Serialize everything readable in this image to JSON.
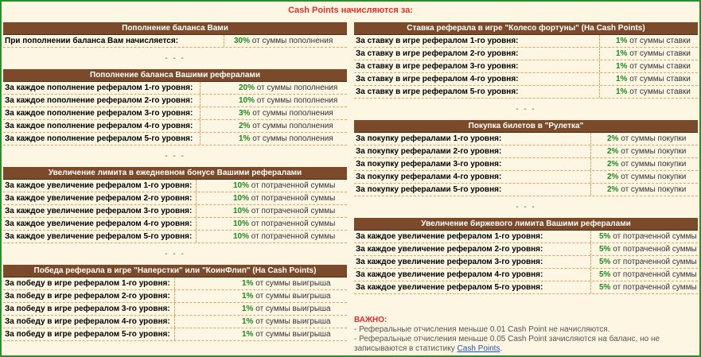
{
  "title": "Cash Points начисляются за:",
  "separator": "- - -",
  "left": [
    {
      "header": "Пополнение баланса Вами",
      "label_w": 275,
      "value_indent": 12,
      "rows": [
        {
          "label": "При пополнении баланса Вам начисляется:",
          "pct": "30%",
          "text": "от суммы пополнения"
        }
      ]
    },
    {
      "header": "Пополнение баланса Вашими рефералами",
      "label_w": 245,
      "value_indent": 48,
      "rows": [
        {
          "label": "За каждое пополнение рефералом 1-го уровня:",
          "pct": "20%",
          "text": "от суммы пополнения"
        },
        {
          "label": "За каждое пополнение рефералом 2-го уровня:",
          "pct": "10%",
          "text": "от суммы пополнения"
        },
        {
          "label": "За каждое пополнение рефералом 3-го уровня:",
          "pct": "3%",
          "text": "от суммы пополнения"
        },
        {
          "label": "За каждое пополнение рефералом 4-го уровня:",
          "pct": "2%",
          "text": "от суммы пополнения"
        },
        {
          "label": "За каждое пополнение рефералом 5-го уровня:",
          "pct": "1%",
          "text": "от суммы пополнения"
        }
      ]
    },
    {
      "header": "Увеличение лимита в ежедневном бонусе Вашими рефералами",
      "label_w": 240,
      "value_indent": 46,
      "rows": [
        {
          "label": "За каждое увеличение рефералом 1-го уровня:",
          "pct": "10%",
          "text": "от потраченной суммы"
        },
        {
          "label": "За каждое увеличение рефералом 2-го уровня:",
          "pct": "10%",
          "text": "от потраченной суммы"
        },
        {
          "label": "За каждое увеличение рефералом 3-го уровня:",
          "pct": "10%",
          "text": "от потраченной суммы"
        },
        {
          "label": "За каждое увеличение рефералом 4-го уровня:",
          "pct": "10%",
          "text": "от потраченной суммы"
        },
        {
          "label": "За каждое увеличение рефералом 5-го уровня:",
          "pct": "10%",
          "text": "от потраченной суммы"
        }
      ]
    },
    {
      "header": "Победа реферала в игре \"Наперстки\" или \"КоинФлип\" (На Cash Points)",
      "label_w": 213,
      "value_indent": 84,
      "rows": [
        {
          "label": "За победу в игре рефералом 1-го уровня:",
          "pct": "1%",
          "text": "от суммы выигрыша"
        },
        {
          "label": "За победу в игре рефералом 2-го уровня:",
          "pct": "1%",
          "text": "от суммы выигрыша"
        },
        {
          "label": "За победу в игре рефералом 3-го уровня:",
          "pct": "1%",
          "text": "от суммы выигрыша"
        },
        {
          "label": "За победу в игре рефералом 4-го уровня:",
          "pct": "1%",
          "text": "от суммы выигрыша"
        },
        {
          "label": "За победу в игре рефералом 5-го уровня:",
          "pct": "1%",
          "text": "от суммы выигрыша"
        }
      ]
    }
  ],
  "right": [
    {
      "header": "Ставка реферала в игре \"Колесо фортуны\" (На Cash Points)",
      "label_w": 306,
      "value_indent": 20,
      "rows": [
        {
          "label": "За ставку в игре рефералом 1-го уровня:",
          "pct": "1%",
          "text": "от суммы ставки"
        },
        {
          "label": "За ставку в игре рефералом 2-го уровня:",
          "pct": "1%",
          "text": "от суммы ставки"
        },
        {
          "label": "За ставку в игре рефералом 3-го уровня:",
          "pct": "1%",
          "text": "от суммы ставки"
        },
        {
          "label": "За ставку в игре рефералом 4-го уровня:",
          "pct": "1%",
          "text": "от суммы ставки"
        },
        {
          "label": "За ставку в игре рефералом 5-го уровня:",
          "pct": "1%",
          "text": "от суммы ставки"
        }
      ]
    },
    {
      "header": "Покупка билетов в \"Рулетка\"",
      "label_w": 295,
      "value_indent": 20,
      "rows": [
        {
          "label": "За покупку рефералами 1-го уровня:",
          "pct": "2%",
          "text": "от суммы покупки"
        },
        {
          "label": "За покупку рефералами 2-го уровня:",
          "pct": "2%",
          "text": "от суммы покупки"
        },
        {
          "label": "За покупку рефералами 3-го уровня:",
          "pct": "2%",
          "text": "от суммы покупки"
        },
        {
          "label": "За покупку рефералами 4-го уровня:",
          "pct": "2%",
          "text": "от суммы покупки"
        },
        {
          "label": "За покупку рефералами 5-го уровня:",
          "pct": "2%",
          "text": "от суммы покупки"
        }
      ]
    },
    {
      "header": "Увеличение биржевого лимита Вашими рефералами",
      "label_w": 295,
      "value_indent": 10,
      "rows": [
        {
          "label": "За каждое увеличение рефералом 1-го уровня:",
          "pct": "5%",
          "text": "от потраченной суммы"
        },
        {
          "label": "За каждое увеличение рефералом 2-го уровня:",
          "pct": "5%",
          "text": "от потраченной суммы"
        },
        {
          "label": "За каждое увеличение рефералом 3-го уровня:",
          "pct": "5%",
          "text": "от потраченной суммы"
        },
        {
          "label": "За каждое увеличение рефералом 4-го уровня:",
          "pct": "5%",
          "text": "от потраченной суммы"
        },
        {
          "label": "За каждое увеличение рефералом 5-го уровня:",
          "pct": "5%",
          "text": "от потраченной суммы"
        }
      ]
    }
  ],
  "important": {
    "title": "ВАЖНО:",
    "line1": "- Реферальные отчисления меньше 0.01 Cash Point не начисляются.",
    "line2": "- Реферальные отчисления меньше 0.05 Cash Point зачисляются на баланс, но не записываются в статистику",
    "link": "Cash Points",
    "end": "."
  },
  "colors": {
    "background": "#fdf6e3",
    "header": "#7b4a2a",
    "title": "#e03030",
    "percent": "#1e8a1e",
    "border": "#2e8b2e"
  }
}
